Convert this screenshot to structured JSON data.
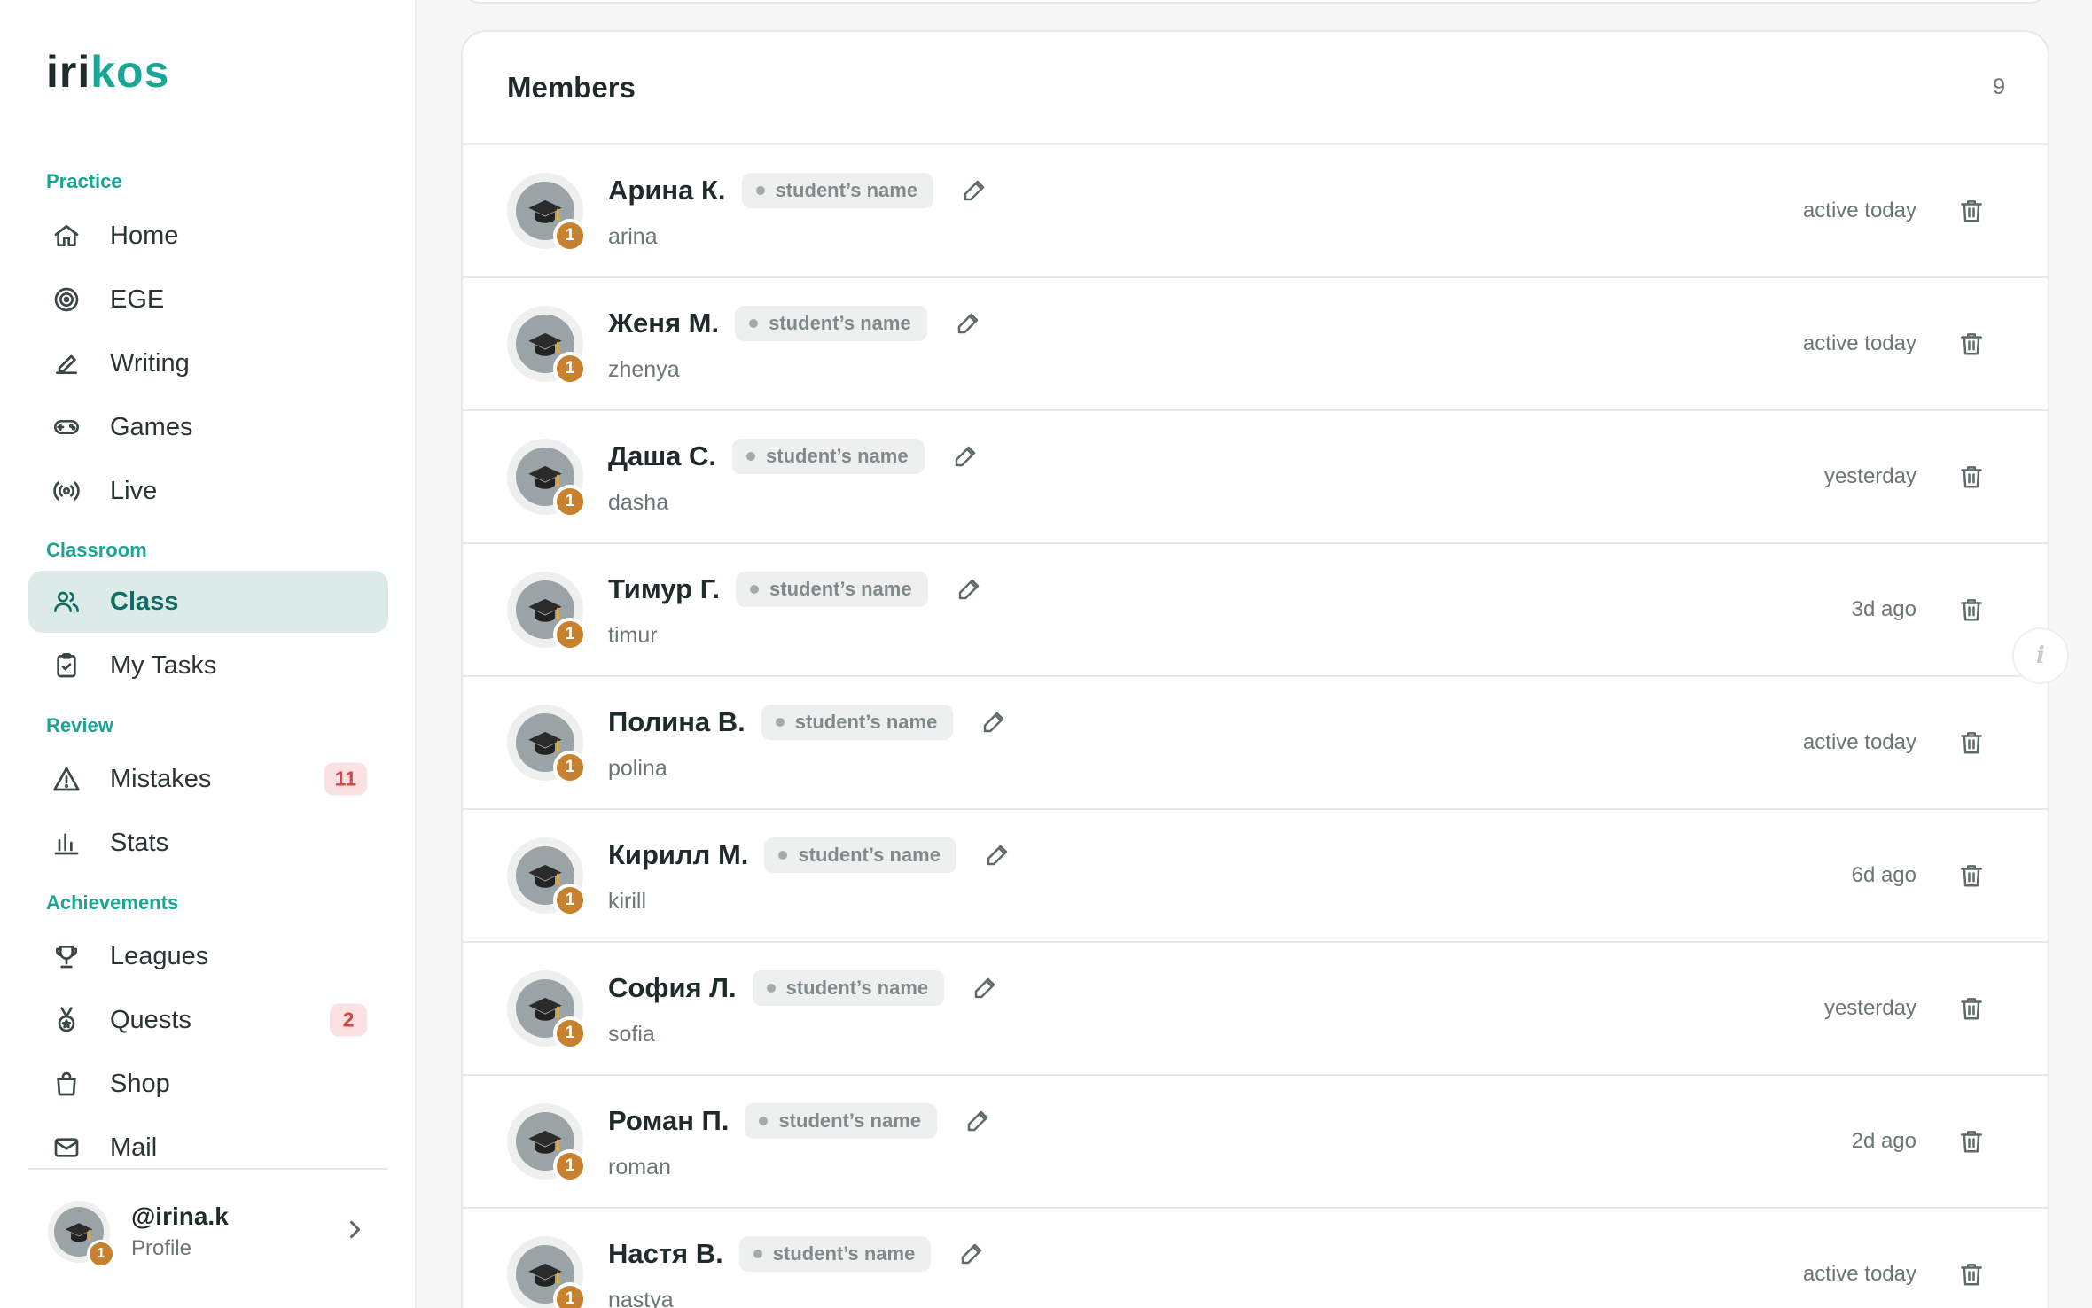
{
  "app": {
    "logo_part1": "iri",
    "logo_part2": "kos"
  },
  "sidebar": {
    "sections": {
      "practice": "Practice",
      "classroom": "Classroom",
      "review": "Review",
      "achievements": "Achievements"
    },
    "items": {
      "home": "Home",
      "ege": "EGE",
      "writing": "Writing",
      "games": "Games",
      "live": "Live",
      "class": "Class",
      "tasks": "My Tasks",
      "mistakes": "Mistakes",
      "stats": "Stats",
      "leagues": "Leagues",
      "quests": "Quests",
      "shop": "Shop",
      "mail": "Mail"
    },
    "badges": {
      "mistakes": "11",
      "quests": "2"
    },
    "profile": {
      "handle": "@irina.k",
      "label": "Profile",
      "level": "1"
    }
  },
  "members": {
    "title": "Members",
    "count": "9",
    "chip_label": "student’s name",
    "list": [
      {
        "name": "Арина К.",
        "username": "arina",
        "activity": "active today",
        "level": "1"
      },
      {
        "name": "Женя М.",
        "username": "zhenya",
        "activity": "active today",
        "level": "1"
      },
      {
        "name": "Даша С.",
        "username": "dasha",
        "activity": "yesterday",
        "level": "1"
      },
      {
        "name": "Тимур Г.",
        "username": "timur",
        "activity": "3d ago",
        "level": "1"
      },
      {
        "name": "Полина В.",
        "username": "polina",
        "activity": "active today",
        "level": "1"
      },
      {
        "name": "Кирилл М.",
        "username": "kirill",
        "activity": "6d ago",
        "level": "1"
      },
      {
        "name": "София Л.",
        "username": "sofia",
        "activity": "yesterday",
        "level": "1"
      },
      {
        "name": "Роман П.",
        "username": "roman",
        "activity": "2d ago",
        "level": "1"
      },
      {
        "name": "Настя В.",
        "username": "nastya",
        "activity": "active today",
        "level": "1"
      }
    ]
  },
  "info_button": "i",
  "colors": {
    "accent": "#1aa595",
    "active_bg": "#dcebe7",
    "badge_red": "#d24545",
    "level_badge": "#c8822f"
  }
}
